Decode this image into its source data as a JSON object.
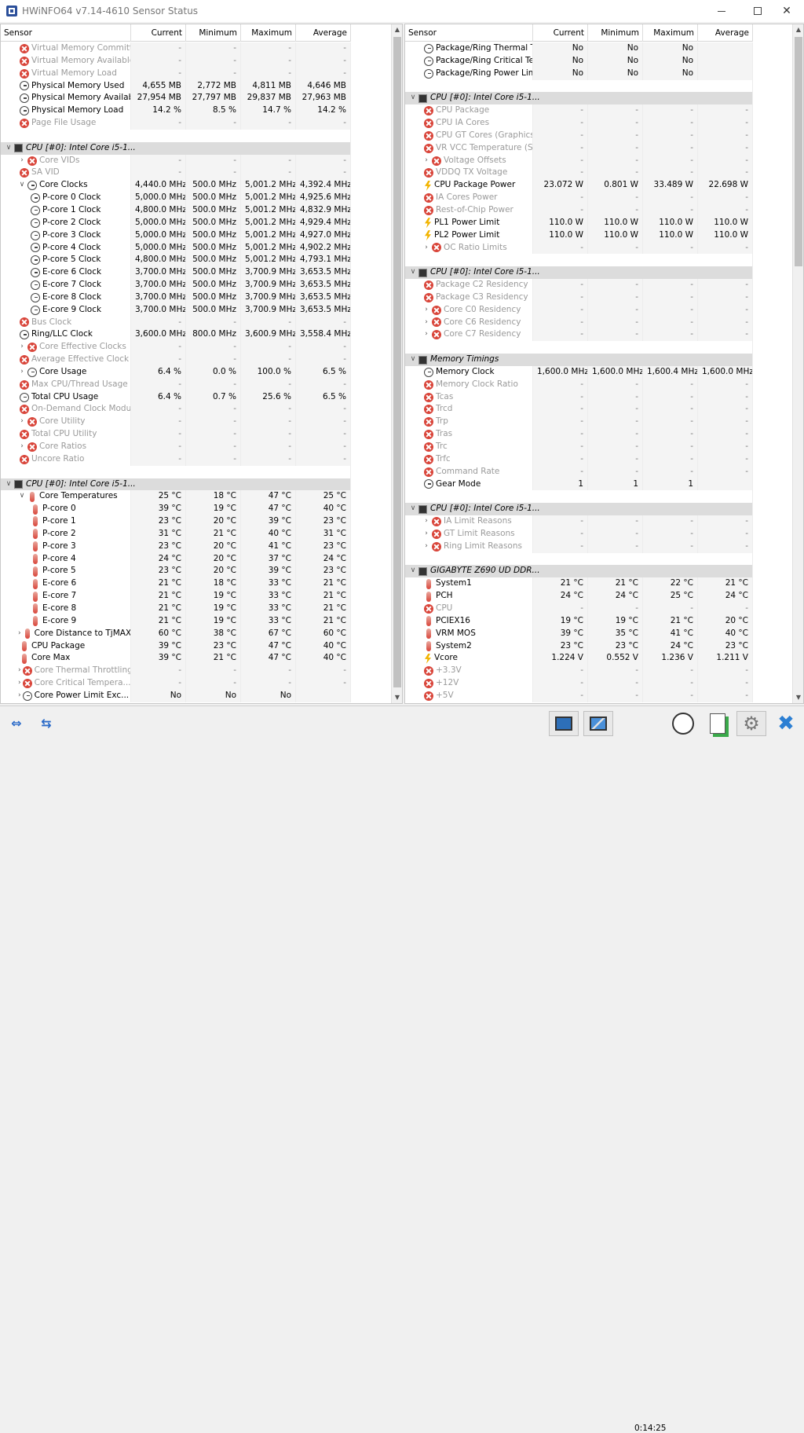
{
  "window": {
    "title": "HWiNFO64 v7.14-4610 Sensor Status"
  },
  "columns": {
    "sensor": "Sensor",
    "current": "Current",
    "minimum": "Minimum",
    "maximum": "Maximum",
    "average": "Average"
  },
  "left_rows": [
    {
      "t": "row",
      "icon": "err",
      "label": "Virtual Memory Committed",
      "cur": "-",
      "min": "-",
      "max": "-",
      "avg": "-",
      "dis": true
    },
    {
      "t": "row",
      "icon": "err",
      "label": "Virtual Memory Available",
      "cur": "-",
      "min": "-",
      "max": "-",
      "avg": "-",
      "dis": true
    },
    {
      "t": "row",
      "icon": "err",
      "label": "Virtual Memory Load",
      "cur": "-",
      "min": "-",
      "max": "-",
      "avg": "-",
      "dis": true
    },
    {
      "t": "row",
      "icon": "gauge",
      "label": "Physical Memory Used",
      "cur": "4,655 MB",
      "min": "2,772 MB",
      "max": "4,811 MB",
      "avg": "4,646 MB"
    },
    {
      "t": "row",
      "icon": "gauge",
      "label": "Physical Memory Available",
      "cur": "27,954 MB",
      "min": "27,797 MB",
      "max": "29,837 MB",
      "avg": "27,963 MB"
    },
    {
      "t": "row",
      "icon": "gauge",
      "label": "Physical Memory Load",
      "cur": "14.2 %",
      "min": "8.5 %",
      "max": "14.7 %",
      "avg": "14.2 %"
    },
    {
      "t": "row",
      "icon": "err",
      "label": "Page File Usage",
      "cur": "-",
      "min": "-",
      "max": "-",
      "avg": "-",
      "dis": true
    },
    {
      "t": "blank"
    },
    {
      "t": "head",
      "label": "CPU [#0]: Intel Core i5-1..."
    },
    {
      "t": "row",
      "ind": 1,
      "exp": ">",
      "icon": "err",
      "label": "Core VIDs",
      "cur": "-",
      "min": "-",
      "max": "-",
      "avg": "-",
      "dis": true
    },
    {
      "t": "row",
      "icon": "err",
      "label": "SA VID",
      "cur": "-",
      "min": "-",
      "max": "-",
      "avg": "-",
      "dis": true
    },
    {
      "t": "row",
      "ind": 1,
      "exp": "v",
      "icon": "gauge",
      "label": "Core Clocks",
      "cur": "4,440.0 MHz",
      "min": "500.0 MHz",
      "max": "5,001.2 MHz",
      "avg": "4,392.4 MHz"
    },
    {
      "t": "row",
      "ind": 2,
      "icon": "gauge",
      "label": "P-core 0 Clock",
      "cur": "5,000.0 MHz",
      "min": "500.0 MHz",
      "max": "5,001.2 MHz",
      "avg": "4,925.6 MHz"
    },
    {
      "t": "row",
      "ind": 2,
      "icon": "gauge",
      "label": "P-core 1 Clock",
      "cur": "4,800.0 MHz",
      "min": "500.0 MHz",
      "max": "5,001.2 MHz",
      "avg": "4,832.9 MHz"
    },
    {
      "t": "row",
      "ind": 2,
      "icon": "gauge",
      "label": "P-core 2 Clock",
      "cur": "5,000.0 MHz",
      "min": "500.0 MHz",
      "max": "5,001.2 MHz",
      "avg": "4,929.4 MHz"
    },
    {
      "t": "row",
      "ind": 2,
      "icon": "gauge",
      "label": "P-core 3 Clock",
      "cur": "5,000.0 MHz",
      "min": "500.0 MHz",
      "max": "5,001.2 MHz",
      "avg": "4,927.0 MHz"
    },
    {
      "t": "row",
      "ind": 2,
      "icon": "gauge",
      "label": "P-core 4 Clock",
      "cur": "5,000.0 MHz",
      "min": "500.0 MHz",
      "max": "5,001.2 MHz",
      "avg": "4,902.2 MHz"
    },
    {
      "t": "row",
      "ind": 2,
      "icon": "gauge",
      "label": "P-core 5 Clock",
      "cur": "4,800.0 MHz",
      "min": "500.0 MHz",
      "max": "5,001.2 MHz",
      "avg": "4,793.1 MHz"
    },
    {
      "t": "row",
      "ind": 2,
      "icon": "gauge",
      "label": "E-core 6 Clock",
      "cur": "3,700.0 MHz",
      "min": "500.0 MHz",
      "max": "3,700.9 MHz",
      "avg": "3,653.5 MHz"
    },
    {
      "t": "row",
      "ind": 2,
      "icon": "gauge",
      "label": "E-core 7 Clock",
      "cur": "3,700.0 MHz",
      "min": "500.0 MHz",
      "max": "3,700.9 MHz",
      "avg": "3,653.5 MHz"
    },
    {
      "t": "row",
      "ind": 2,
      "icon": "gauge",
      "label": "E-core 8 Clock",
      "cur": "3,700.0 MHz",
      "min": "500.0 MHz",
      "max": "3,700.9 MHz",
      "avg": "3,653.5 MHz"
    },
    {
      "t": "row",
      "ind": 2,
      "icon": "gauge",
      "label": "E-core 9 Clock",
      "cur": "3,700.0 MHz",
      "min": "500.0 MHz",
      "max": "3,700.9 MHz",
      "avg": "3,653.5 MHz"
    },
    {
      "t": "row",
      "icon": "err",
      "label": "Bus Clock",
      "cur": "-",
      "min": "-",
      "max": "-",
      "avg": "-",
      "dis": true
    },
    {
      "t": "row",
      "icon": "gauge",
      "label": "Ring/LLC Clock",
      "cur": "3,600.0 MHz",
      "min": "800.0 MHz",
      "max": "3,600.9 MHz",
      "avg": "3,558.4 MHz"
    },
    {
      "t": "row",
      "ind": 1,
      "exp": ">",
      "icon": "err",
      "label": "Core Effective Clocks",
      "cur": "-",
      "min": "-",
      "max": "-",
      "avg": "-",
      "dis": true
    },
    {
      "t": "row",
      "icon": "err",
      "label": "Average Effective Clock",
      "cur": "-",
      "min": "-",
      "max": "-",
      "avg": "-",
      "dis": true
    },
    {
      "t": "row",
      "ind": 1,
      "exp": ">",
      "icon": "gauge",
      "label": "Core Usage",
      "cur": "6.4 %",
      "min": "0.0 %",
      "max": "100.0 %",
      "avg": "6.5 %"
    },
    {
      "t": "row",
      "icon": "err",
      "label": "Max CPU/Thread Usage",
      "cur": "-",
      "min": "-",
      "max": "-",
      "avg": "-",
      "dis": true
    },
    {
      "t": "row",
      "icon": "gauge",
      "label": "Total CPU Usage",
      "cur": "6.4 %",
      "min": "0.7 %",
      "max": "25.6 %",
      "avg": "6.5 %"
    },
    {
      "t": "row",
      "icon": "err",
      "label": "On-Demand Clock Modul...",
      "cur": "-",
      "min": "-",
      "max": "-",
      "avg": "-",
      "dis": true
    },
    {
      "t": "row",
      "ind": 1,
      "exp": ">",
      "icon": "err",
      "label": "Core Utility",
      "cur": "-",
      "min": "-",
      "max": "-",
      "avg": "-",
      "dis": true
    },
    {
      "t": "row",
      "icon": "err",
      "label": "Total CPU Utility",
      "cur": "-",
      "min": "-",
      "max": "-",
      "avg": "-",
      "dis": true
    },
    {
      "t": "row",
      "ind": 1,
      "exp": ">",
      "icon": "err",
      "label": "Core Ratios",
      "cur": "-",
      "min": "-",
      "max": "-",
      "avg": "-",
      "dis": true
    },
    {
      "t": "row",
      "icon": "err",
      "label": "Uncore Ratio",
      "cur": "-",
      "min": "-",
      "max": "-",
      "avg": "-",
      "dis": true
    },
    {
      "t": "blank"
    },
    {
      "t": "head",
      "label": "CPU [#0]: Intel Core i5-1..."
    },
    {
      "t": "row",
      "ind": 1,
      "exp": "v",
      "icon": "therm",
      "label": "Core Temperatures",
      "cur": "25 °C",
      "min": "18 °C",
      "max": "47 °C",
      "avg": "25 °C"
    },
    {
      "t": "row",
      "ind": 2,
      "icon": "therm",
      "label": "P-core 0",
      "cur": "39 °C",
      "min": "19 °C",
      "max": "47 °C",
      "avg": "40 °C"
    },
    {
      "t": "row",
      "ind": 2,
      "icon": "therm",
      "label": "P-core 1",
      "cur": "23 °C",
      "min": "20 °C",
      "max": "39 °C",
      "avg": "23 °C"
    },
    {
      "t": "row",
      "ind": 2,
      "icon": "therm",
      "label": "P-core 2",
      "cur": "31 °C",
      "min": "21 °C",
      "max": "40 °C",
      "avg": "31 °C"
    },
    {
      "t": "row",
      "ind": 2,
      "icon": "therm",
      "label": "P-core 3",
      "cur": "23 °C",
      "min": "20 °C",
      "max": "41 °C",
      "avg": "23 °C"
    },
    {
      "t": "row",
      "ind": 2,
      "icon": "therm",
      "label": "P-core 4",
      "cur": "24 °C",
      "min": "20 °C",
      "max": "37 °C",
      "avg": "24 °C"
    },
    {
      "t": "row",
      "ind": 2,
      "icon": "therm",
      "label": "P-core 5",
      "cur": "23 °C",
      "min": "20 °C",
      "max": "39 °C",
      "avg": "23 °C"
    },
    {
      "t": "row",
      "ind": 2,
      "icon": "therm",
      "label": "E-core 6",
      "cur": "21 °C",
      "min": "18 °C",
      "max": "33 °C",
      "avg": "21 °C"
    },
    {
      "t": "row",
      "ind": 2,
      "icon": "therm",
      "label": "E-core 7",
      "cur": "21 °C",
      "min": "19 °C",
      "max": "33 °C",
      "avg": "21 °C"
    },
    {
      "t": "row",
      "ind": 2,
      "icon": "therm",
      "label": "E-core 8",
      "cur": "21 °C",
      "min": "19 °C",
      "max": "33 °C",
      "avg": "21 °C"
    },
    {
      "t": "row",
      "ind": 2,
      "icon": "therm",
      "label": "E-core 9",
      "cur": "21 °C",
      "min": "19 °C",
      "max": "33 °C",
      "avg": "21 °C"
    },
    {
      "t": "row",
      "ind": 1,
      "exp": ">",
      "icon": "therm",
      "label": "Core Distance to TjMAX",
      "cur": "60 °C",
      "min": "38 °C",
      "max": "67 °C",
      "avg": "60 °C"
    },
    {
      "t": "row",
      "icon": "therm",
      "label": "CPU Package",
      "cur": "39 °C",
      "min": "23 °C",
      "max": "47 °C",
      "avg": "40 °C"
    },
    {
      "t": "row",
      "icon": "therm",
      "label": "Core Max",
      "cur": "39 °C",
      "min": "21 °C",
      "max": "47 °C",
      "avg": "40 °C"
    },
    {
      "t": "row",
      "ind": 1,
      "exp": ">",
      "icon": "err",
      "label": "Core Thermal Throttling",
      "cur": "-",
      "min": "-",
      "max": "-",
      "avg": "-",
      "dis": true
    },
    {
      "t": "row",
      "ind": 1,
      "exp": ">",
      "icon": "err",
      "label": "Core Critical Tempera...",
      "cur": "-",
      "min": "-",
      "max": "-",
      "avg": "-",
      "dis": true
    },
    {
      "t": "row",
      "ind": 1,
      "exp": ">",
      "icon": "gauge",
      "label": "Core Power Limit Exc...",
      "cur": "No",
      "min": "No",
      "max": "No",
      "avg": ""
    }
  ],
  "right_rows": [
    {
      "t": "row",
      "icon": "gauge",
      "label": "Package/Ring Thermal Th...",
      "cur": "No",
      "min": "No",
      "max": "No",
      "avg": ""
    },
    {
      "t": "row",
      "icon": "gauge",
      "label": "Package/Ring Critical Te...",
      "cur": "No",
      "min": "No",
      "max": "No",
      "avg": ""
    },
    {
      "t": "row",
      "icon": "gauge",
      "label": "Package/Ring Power Limi...",
      "cur": "No",
      "min": "No",
      "max": "No",
      "avg": ""
    },
    {
      "t": "blank"
    },
    {
      "t": "head",
      "label": "CPU [#0]: Intel Core i5-1..."
    },
    {
      "t": "row",
      "icon": "err",
      "label": "CPU Package",
      "cur": "-",
      "min": "-",
      "max": "-",
      "avg": "-",
      "dis": true
    },
    {
      "t": "row",
      "icon": "err",
      "label": "CPU IA Cores",
      "cur": "-",
      "min": "-",
      "max": "-",
      "avg": "-",
      "dis": true
    },
    {
      "t": "row",
      "icon": "err",
      "label": "CPU GT Cores (Graphics)",
      "cur": "-",
      "min": "-",
      "max": "-",
      "avg": "-",
      "dis": true
    },
    {
      "t": "row",
      "icon": "err",
      "label": "VR VCC Temperature (SV...",
      "cur": "-",
      "min": "-",
      "max": "-",
      "avg": "-",
      "dis": true
    },
    {
      "t": "row",
      "ind": 1,
      "exp": ">",
      "icon": "err",
      "label": "Voltage Offsets",
      "cur": "-",
      "min": "-",
      "max": "-",
      "avg": "-",
      "dis": true
    },
    {
      "t": "row",
      "icon": "err",
      "label": "VDDQ TX Voltage",
      "cur": "-",
      "min": "-",
      "max": "-",
      "avg": "-",
      "dis": true
    },
    {
      "t": "row",
      "icon": "bolt",
      "label": "CPU Package Power",
      "cur": "23.072 W",
      "min": "0.801 W",
      "max": "33.489 W",
      "avg": "22.698 W"
    },
    {
      "t": "row",
      "icon": "err",
      "label": "IA Cores Power",
      "cur": "-",
      "min": "-",
      "max": "-",
      "avg": "-",
      "dis": true
    },
    {
      "t": "row",
      "icon": "err",
      "label": "Rest-of-Chip Power",
      "cur": "-",
      "min": "-",
      "max": "-",
      "avg": "-",
      "dis": true
    },
    {
      "t": "row",
      "icon": "bolt",
      "label": "PL1 Power Limit",
      "cur": "110.0 W",
      "min": "110.0 W",
      "max": "110.0 W",
      "avg": "110.0 W"
    },
    {
      "t": "row",
      "icon": "bolt",
      "label": "PL2 Power Limit",
      "cur": "110.0 W",
      "min": "110.0 W",
      "max": "110.0 W",
      "avg": "110.0 W"
    },
    {
      "t": "row",
      "ind": 1,
      "exp": ">",
      "icon": "err",
      "label": "OC Ratio Limits",
      "cur": "-",
      "min": "-",
      "max": "-",
      "avg": "-",
      "dis": true
    },
    {
      "t": "blank"
    },
    {
      "t": "head",
      "label": "CPU [#0]: Intel Core i5-1..."
    },
    {
      "t": "row",
      "icon": "err",
      "label": "Package C2 Residency",
      "cur": "-",
      "min": "-",
      "max": "-",
      "avg": "-",
      "dis": true
    },
    {
      "t": "row",
      "icon": "err",
      "label": "Package C3 Residency",
      "cur": "-",
      "min": "-",
      "max": "-",
      "avg": "-",
      "dis": true
    },
    {
      "t": "row",
      "ind": 1,
      "exp": ">",
      "icon": "err",
      "label": "Core C0 Residency",
      "cur": "-",
      "min": "-",
      "max": "-",
      "avg": "-",
      "dis": true
    },
    {
      "t": "row",
      "ind": 1,
      "exp": ">",
      "icon": "err",
      "label": "Core C6 Residency",
      "cur": "-",
      "min": "-",
      "max": "-",
      "avg": "-",
      "dis": true
    },
    {
      "t": "row",
      "ind": 1,
      "exp": ">",
      "icon": "err",
      "label": "Core C7 Residency",
      "cur": "-",
      "min": "-",
      "max": "-",
      "avg": "-",
      "dis": true
    },
    {
      "t": "blank"
    },
    {
      "t": "head",
      "label": "Memory Timings"
    },
    {
      "t": "row",
      "icon": "gauge",
      "label": "Memory Clock",
      "cur": "1,600.0 MHz",
      "min": "1,600.0 MHz",
      "max": "1,600.4 MHz",
      "avg": "1,600.0 MHz"
    },
    {
      "t": "row",
      "icon": "err",
      "label": "Memory Clock Ratio",
      "cur": "-",
      "min": "-",
      "max": "-",
      "avg": "-",
      "dis": true
    },
    {
      "t": "row",
      "icon": "err",
      "label": "Tcas",
      "cur": "-",
      "min": "-",
      "max": "-",
      "avg": "-",
      "dis": true
    },
    {
      "t": "row",
      "icon": "err",
      "label": "Trcd",
      "cur": "-",
      "min": "-",
      "max": "-",
      "avg": "-",
      "dis": true
    },
    {
      "t": "row",
      "icon": "err",
      "label": "Trp",
      "cur": "-",
      "min": "-",
      "max": "-",
      "avg": "-",
      "dis": true
    },
    {
      "t": "row",
      "icon": "err",
      "label": "Tras",
      "cur": "-",
      "min": "-",
      "max": "-",
      "avg": "-",
      "dis": true
    },
    {
      "t": "row",
      "icon": "err",
      "label": "Trc",
      "cur": "-",
      "min": "-",
      "max": "-",
      "avg": "-",
      "dis": true
    },
    {
      "t": "row",
      "icon": "err",
      "label": "Trfc",
      "cur": "-",
      "min": "-",
      "max": "-",
      "avg": "-",
      "dis": true
    },
    {
      "t": "row",
      "icon": "err",
      "label": "Command Rate",
      "cur": "-",
      "min": "-",
      "max": "-",
      "avg": "-",
      "dis": true
    },
    {
      "t": "row",
      "icon": "gauge",
      "label": "Gear Mode",
      "cur": "1",
      "min": "1",
      "max": "1",
      "avg": ""
    },
    {
      "t": "blank"
    },
    {
      "t": "head",
      "label": "CPU [#0]: Intel Core i5-1..."
    },
    {
      "t": "row",
      "ind": 1,
      "exp": ">",
      "icon": "err",
      "label": "IA Limit Reasons",
      "cur": "-",
      "min": "-",
      "max": "-",
      "avg": "-",
      "dis": true
    },
    {
      "t": "row",
      "ind": 1,
      "exp": ">",
      "icon": "err",
      "label": "GT Limit Reasons",
      "cur": "-",
      "min": "-",
      "max": "-",
      "avg": "-",
      "dis": true
    },
    {
      "t": "row",
      "ind": 1,
      "exp": ">",
      "icon": "err",
      "label": "Ring Limit Reasons",
      "cur": "-",
      "min": "-",
      "max": "-",
      "avg": "-",
      "dis": true
    },
    {
      "t": "blank"
    },
    {
      "t": "head",
      "label": "GIGABYTE Z690 UD DDR..."
    },
    {
      "t": "row",
      "icon": "therm",
      "label": "System1",
      "cur": "21 °C",
      "min": "21 °C",
      "max": "22 °C",
      "avg": "21 °C"
    },
    {
      "t": "row",
      "icon": "therm",
      "label": "PCH",
      "cur": "24 °C",
      "min": "24 °C",
      "max": "25 °C",
      "avg": "24 °C"
    },
    {
      "t": "row",
      "icon": "err",
      "label": "CPU",
      "cur": "-",
      "min": "-",
      "max": "-",
      "avg": "-",
      "dis": true
    },
    {
      "t": "row",
      "icon": "therm",
      "label": "PCIEX16",
      "cur": "19 °C",
      "min": "19 °C",
      "max": "21 °C",
      "avg": "20 °C"
    },
    {
      "t": "row",
      "icon": "therm",
      "label": "VRM MOS",
      "cur": "39 °C",
      "min": "35 °C",
      "max": "41 °C",
      "avg": "40 °C"
    },
    {
      "t": "row",
      "icon": "therm",
      "label": "System2",
      "cur": "23 °C",
      "min": "23 °C",
      "max": "24 °C",
      "avg": "23 °C"
    },
    {
      "t": "row",
      "icon": "bolt",
      "label": "Vcore",
      "cur": "1.224 V",
      "min": "0.552 V",
      "max": "1.236 V",
      "avg": "1.211 V"
    },
    {
      "t": "row",
      "icon": "err",
      "label": "+3.3V",
      "cur": "-",
      "min": "-",
      "max": "-",
      "avg": "-",
      "dis": true
    },
    {
      "t": "row",
      "icon": "err",
      "label": "+12V",
      "cur": "-",
      "min": "-",
      "max": "-",
      "avg": "-",
      "dis": true
    },
    {
      "t": "row",
      "icon": "err",
      "label": "+5V",
      "cur": "-",
      "min": "-",
      "max": "-",
      "avg": "-",
      "dis": true
    }
  ],
  "toolbar": {
    "timer": "0:14:25"
  }
}
